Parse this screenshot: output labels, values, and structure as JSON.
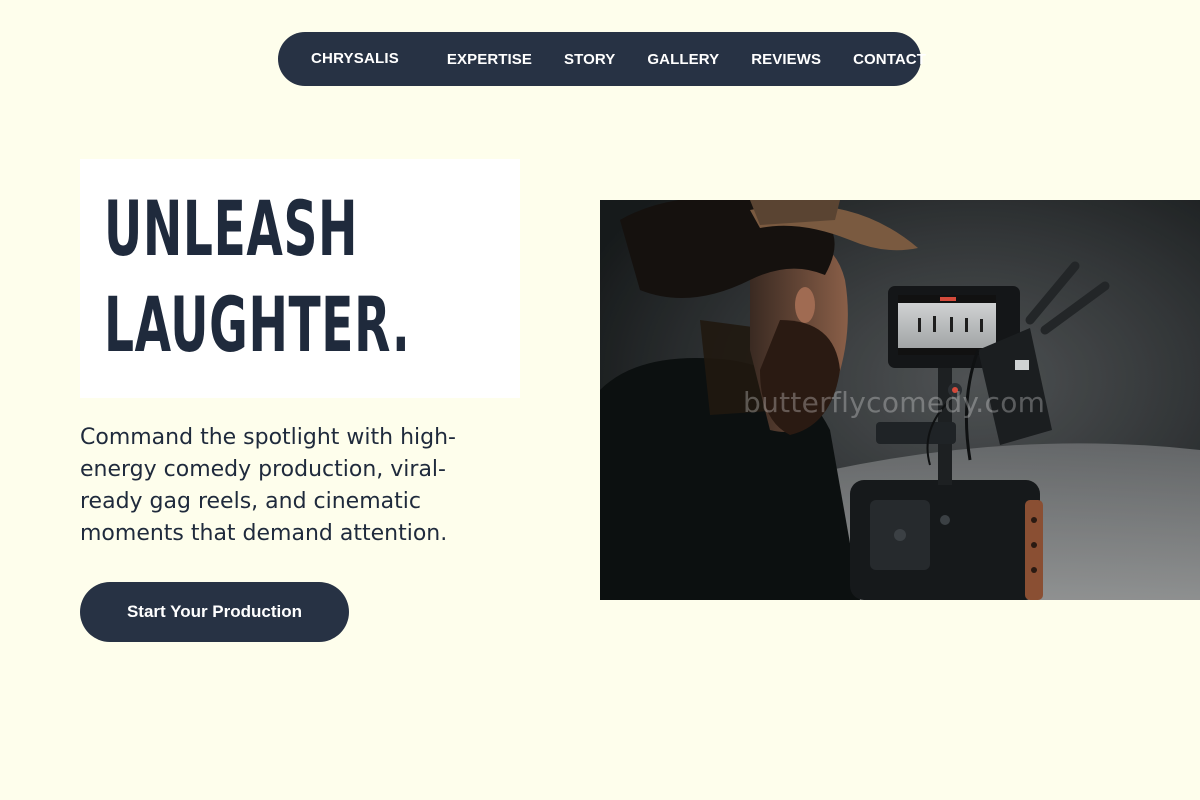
{
  "nav": {
    "brand": "CHRYSALIS",
    "links": [
      {
        "label": "EXPERTISE"
      },
      {
        "label": "STORY"
      },
      {
        "label": "GALLERY"
      },
      {
        "label": "REVIEWS"
      },
      {
        "label": "CONTACT"
      }
    ]
  },
  "hero": {
    "headline_line1": "UNLEASH",
    "headline_line2": "LAUGHTER.",
    "subtext": "Command the spotlight with high-energy comedy production, viral-ready gag reels, and cinematic moments that demand attention.",
    "cta_label": "Start Your Production",
    "watermark": "butterflycomedy.com"
  },
  "colors": {
    "background": "#fefeec",
    "navy": "#273244",
    "text": "#1f2a3c",
    "white": "#ffffff"
  }
}
